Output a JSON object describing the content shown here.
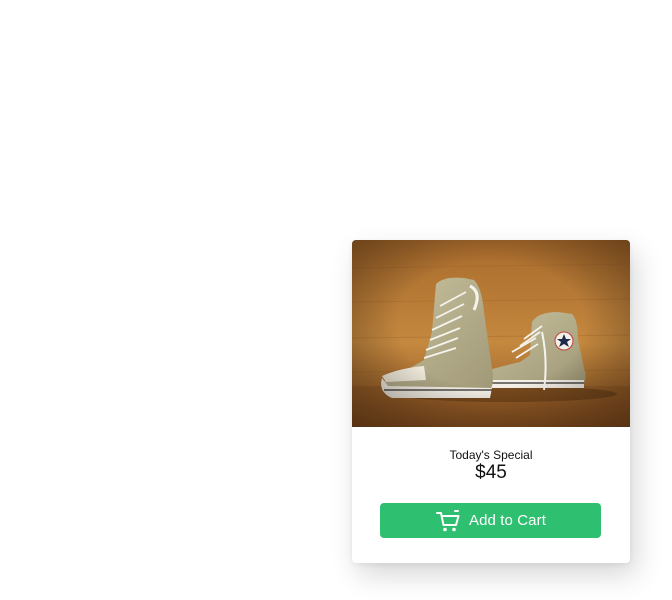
{
  "product": {
    "image_alt": "Pair of khaki high-top canvas sneakers",
    "label": "Today's Special",
    "price": "$45"
  },
  "cart_button": {
    "label": "Add to Cart",
    "icon": "shopping-cart-icon"
  },
  "colors": {
    "button": "#2fbf71",
    "button_text": "#ffffff",
    "text": "#111111",
    "wood": "#b97a36",
    "shoe": "#b8b08d"
  }
}
